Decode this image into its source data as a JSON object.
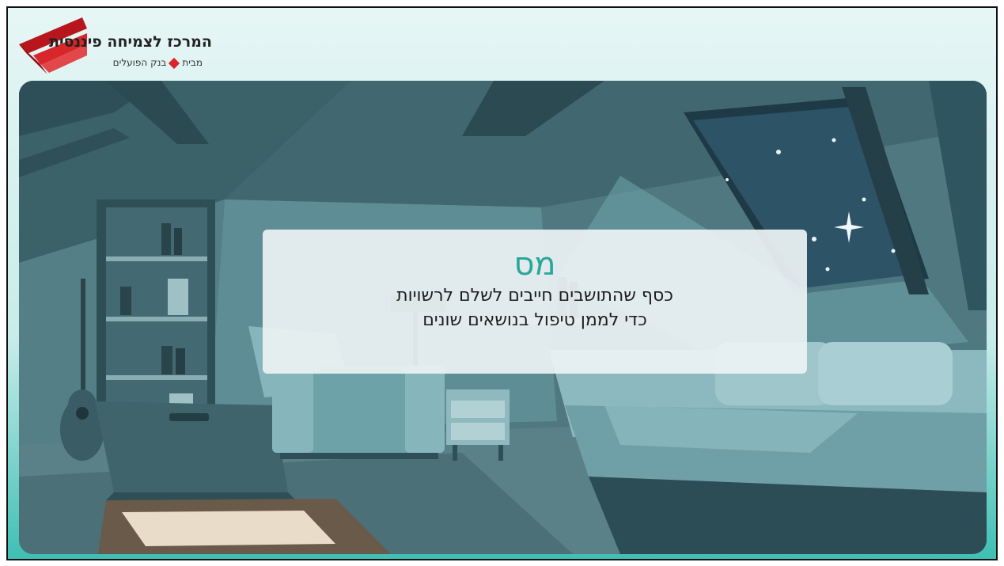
{
  "logo": {
    "title": "המרכז לצמיחה פיננסית",
    "sub_prefix": "מבית",
    "sub_bank": "בנק הפועלים",
    "brand_color": "#d9262a"
  },
  "card": {
    "title": "מס",
    "line1": "כסף שהתושבים חייבים לשלם לרשויות",
    "line2": "כדי לממן טיפול בנושאים שונים",
    "title_color": "#2aa79b"
  },
  "scene": {
    "description_icon": "attic-room-illustration"
  }
}
